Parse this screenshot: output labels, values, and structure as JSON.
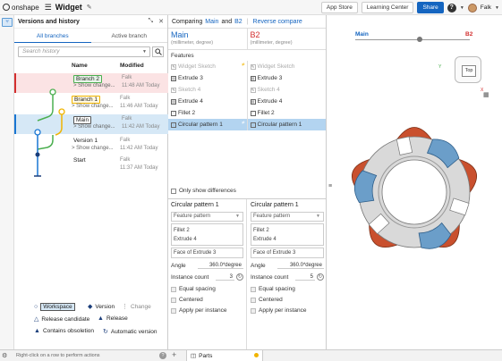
{
  "app": {
    "logo_text": "onshape",
    "doc_title": "Widget",
    "buttons": {
      "app_store": "App Store",
      "learning_center": "Learning Center",
      "share": "Share"
    },
    "help": "?",
    "user": "Falk",
    "accent": "#1565c0"
  },
  "versions_panel": {
    "title": "Versions and history",
    "tabs": [
      "All branches",
      "Active branch"
    ],
    "search_placeholder": "Search history",
    "columns": {
      "name": "Name",
      "modified": "Modified"
    },
    "rows": [
      {
        "name": "Branch 2",
        "sub": "> Show change...",
        "who": "Falk",
        "when": "11:48 AM Today"
      },
      {
        "name": "Branch 1",
        "sub": "> Show change...",
        "who": "Falk",
        "when": "11:46 AM Today"
      },
      {
        "name": "Main",
        "sub": "> Show change...",
        "who": "Falk",
        "when": "11:42 AM Today"
      },
      {
        "name": "Version 1",
        "sub": "> Show change...",
        "who": "Falk",
        "when": "11:42 AM Today"
      },
      {
        "name": "Start",
        "sub": "",
        "who": "Falk",
        "when": "11:37 AM Today"
      }
    ],
    "legend": {
      "workspace": "Workspace",
      "version": "Version",
      "change": "Change",
      "release_candidate": "Release candidate",
      "release": "Release",
      "contains_obsoletion": "Contains obsoletion",
      "automatic_version": "Automatic version"
    },
    "branch_colors": {
      "branch2": "#d32f2f",
      "branch1": "#f0b400",
      "main": "#1976d2",
      "green": "#4caf50"
    }
  },
  "compare": {
    "comparing_label": "Comparing",
    "left": "Main",
    "and_label": "and",
    "right": "B2",
    "reverse": "Reverse compare",
    "units": "(millimeter, degree)",
    "features_label": "Features",
    "features": [
      {
        "left": "Widget Sketch",
        "right": "Widget Sketch",
        "state": "greyed",
        "diff": true
      },
      {
        "left": "Extrude 3",
        "right": "Extrude 3",
        "state": "normal",
        "diff": false
      },
      {
        "left": "Sketch 4",
        "right": "Sketch 4",
        "state": "greyed",
        "diff": false
      },
      {
        "left": "Extrude 4",
        "right": "Extrude 4",
        "state": "normal",
        "diff": false
      },
      {
        "left": "Fillet 2",
        "right": "Fillet 2",
        "state": "normal",
        "diff": false
      },
      {
        "left": "Circular pattern 1",
        "right": "Circular pattern 1",
        "state": "selected",
        "diff": true
      }
    ],
    "only_show_differences": "Only show differences",
    "details": [
      {
        "title": "Circular pattern 1",
        "pattern_type": "Feature pattern",
        "list": [
          "Fillet 2",
          "Extrude 4"
        ],
        "face": "Face of Extrude 3",
        "angle_label": "Angle",
        "angle": "360.0*degree",
        "count_label": "Instance count",
        "count": "3",
        "equal_spacing": "Equal spacing",
        "centered": "Centered",
        "apply_per_instance": "Apply per instance"
      },
      {
        "title": "Circular pattern 1",
        "pattern_type": "Feature pattern",
        "list": [
          "Fillet 2",
          "Extrude 4"
        ],
        "face": "Face of Extrude 3",
        "angle_label": "Angle",
        "angle": "360.0*degree",
        "count_label": "Instance count",
        "count": "5",
        "equal_spacing": "Equal spacing",
        "centered": "Centered",
        "apply_per_instance": "Apply per instance"
      }
    ],
    "main_color": "#1565c0",
    "b2_color": "#d32f2f"
  },
  "viewport": {
    "left_label": "Main",
    "right_label": "B2",
    "cube_face": "Top",
    "axis_y": "Y",
    "axis_x": "X",
    "part_colors": {
      "body": "#d9d9d9",
      "main_lobes": "#6b9ec9",
      "b2_lobes": "#c9502e"
    }
  },
  "bottom": {
    "hint": "Right-click on a row to perform actions",
    "help": "?",
    "plus": "+",
    "tab": "Parts"
  }
}
